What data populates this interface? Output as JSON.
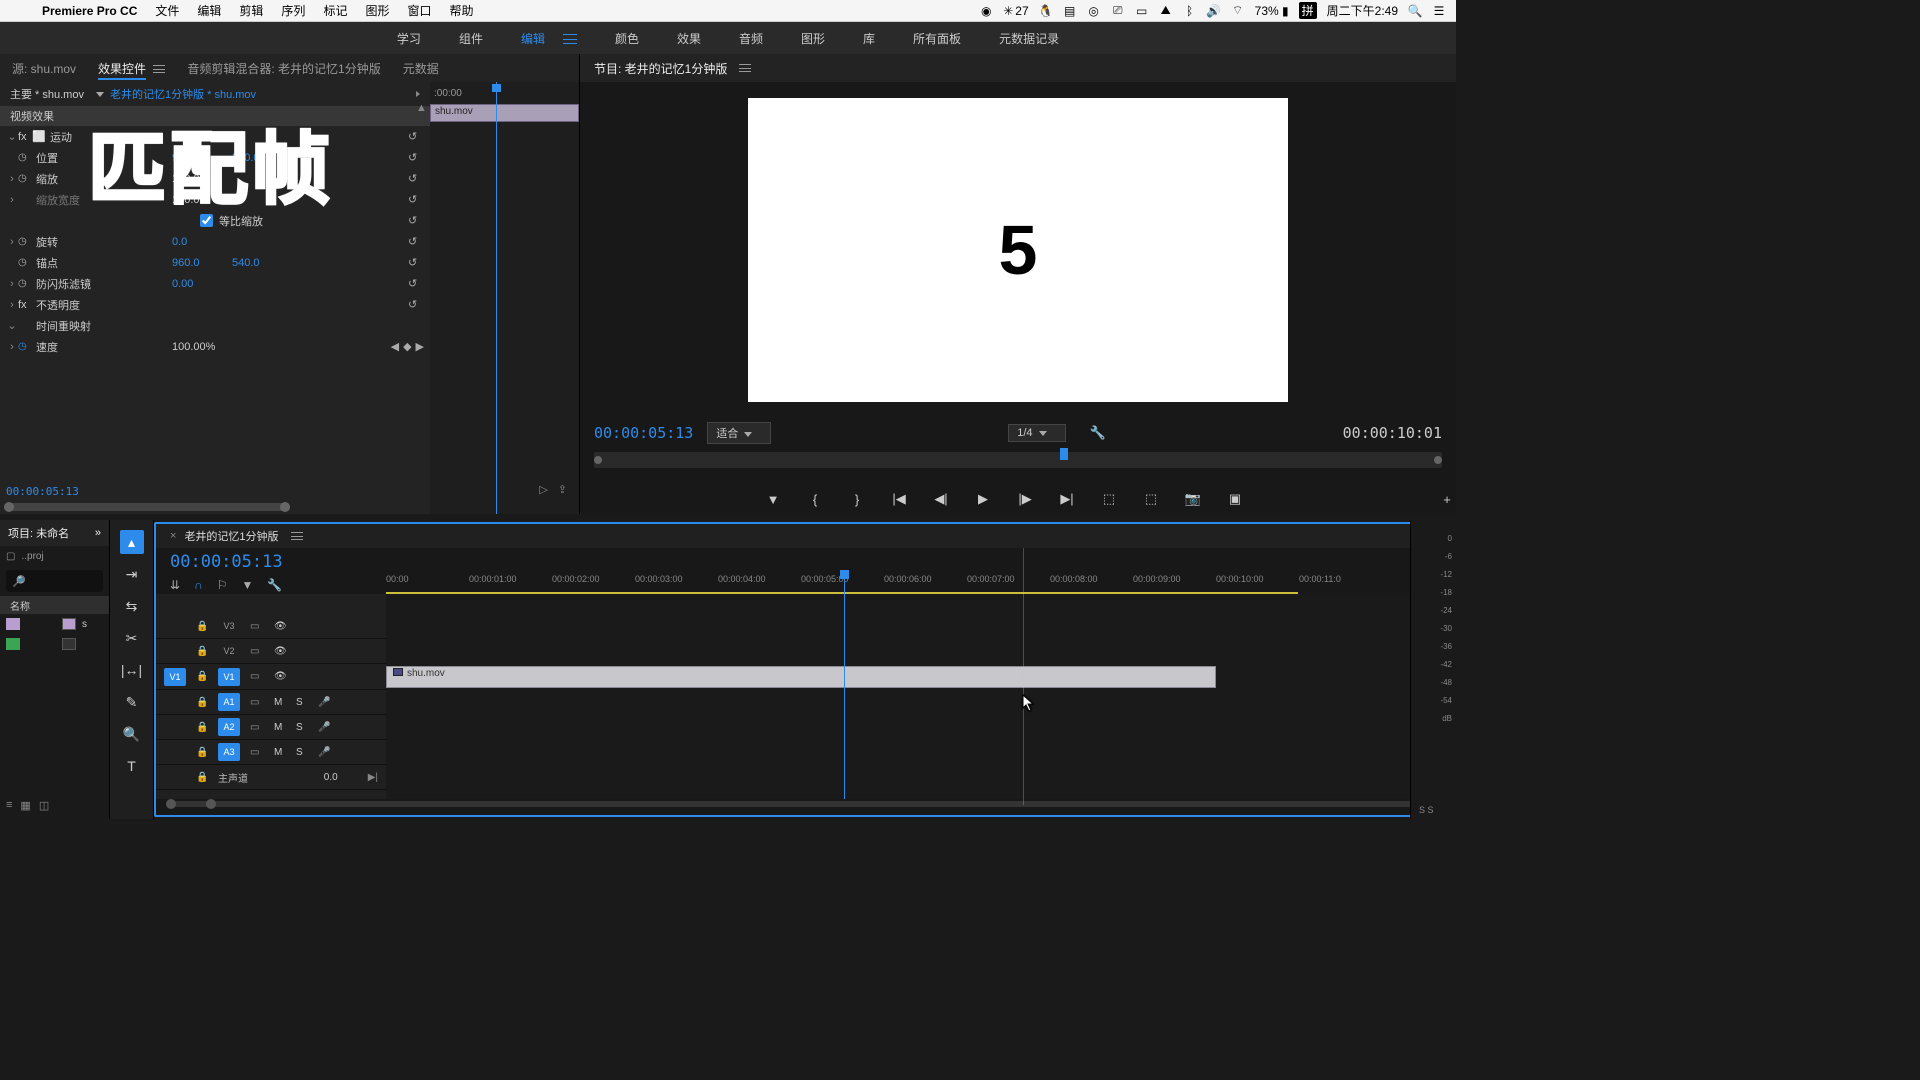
{
  "mac": {
    "app": "Premiere Pro CC",
    "menus": [
      "文件",
      "编辑",
      "剪辑",
      "序列",
      "标记",
      "图形",
      "窗口",
      "帮助"
    ],
    "wechat": "27",
    "battery": "73%",
    "ime": "拼",
    "clock": "周二下午2:49"
  },
  "workspaces": [
    "学习",
    "组件",
    "编辑",
    "颜色",
    "效果",
    "音频",
    "图形",
    "库",
    "所有面板",
    "元数据记录"
  ],
  "source_tabs": {
    "source": "源: shu.mov",
    "effect": "效果控件",
    "mixer": "音频剪辑混合器: 老井的记忆1分钟版",
    "meta": "元数据"
  },
  "ec": {
    "master": "主要 * shu.mov",
    "seq": "老井的记忆1分钟版 * shu.mov",
    "section_video": "视频效果",
    "motion": "运动",
    "position": "位置",
    "posx": "960.0",
    "posy": "540.0",
    "scale": "缩放",
    "scalev": "100.0",
    "scalew": "缩放宽度",
    "scalewv": "100.0",
    "uniform": "等比缩放",
    "rotation": "旋转",
    "rotv": "0.0",
    "anchor": "锚点",
    "anchx": "960.0",
    "anchy": "540.0",
    "flicker": "防闪烁滤镜",
    "flickv": "0.00",
    "opacity": "不透明度",
    "remap": "时间重映射",
    "speed": "速度",
    "speedv": "100.00%",
    "mini_t0": ":00:00",
    "mini_clip": "shu.mov",
    "tc": "00:00:05:13"
  },
  "overlay_big": "匹配帧",
  "program": {
    "title": "节目: 老井的记忆1分钟版",
    "frame_number": "5",
    "tc": "00:00:05:13",
    "fit": "适合",
    "res": "1/4",
    "dur": "00:00:10:01"
  },
  "project": {
    "title": "项目: 未命名",
    "proj": "..proj",
    "colname": "名称",
    "item_s": "s"
  },
  "timeline": {
    "seqname": "老井的记忆1分钟版",
    "tc": "00:00:05:13",
    "ruler": [
      "00:00",
      "00:00:01:00",
      "00:00:02:00",
      "00:00:03:00",
      "00:00:04:00",
      "00:00:05:00",
      "00:00:06:00",
      "00:00:07:00",
      "00:00:08:00",
      "00:00:09:00",
      "00:00:10:00",
      "00:00:11:0"
    ],
    "v3": "V3",
    "v2": "V2",
    "v1": "V1",
    "a1": "A1",
    "a2": "A2",
    "a3": "A3",
    "master": "主声道",
    "mastv": "0.0",
    "clip": "shu.mov"
  },
  "meters": {
    "db": [
      "0",
      "-6",
      "-12",
      "-18",
      "-24",
      "-30",
      "-36",
      "-42",
      "-48",
      "-54",
      "dB"
    ],
    "ss": "S  S"
  }
}
